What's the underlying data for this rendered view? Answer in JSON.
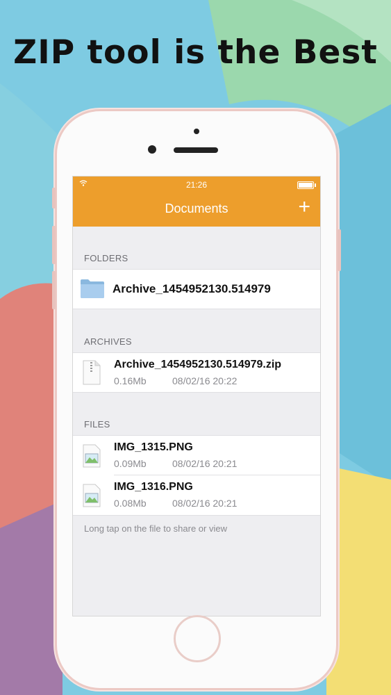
{
  "headline": "ZIP tool is the Best",
  "colors": {
    "accent": "#ed9e2c",
    "background_top": "#7fc9e3"
  },
  "status_bar": {
    "time": "21:26",
    "wifi_icon": "wifi-icon",
    "battery_icon": "battery-icon"
  },
  "nav": {
    "title": "Documents",
    "add_label": "+"
  },
  "sections": {
    "folders": {
      "header": "FOLDERS",
      "items": [
        {
          "name": "Archive_1454952130.514979",
          "icon": "folder-icon"
        }
      ]
    },
    "archives": {
      "header": "ARCHIVES",
      "items": [
        {
          "name": "Archive_1454952130.514979.zip",
          "size": "0.16Mb",
          "date": "08/02/16 20:22",
          "icon": "zip-file-icon"
        }
      ]
    },
    "files": {
      "header": "FILES",
      "items": [
        {
          "name": "IMG_1315.PNG",
          "size": "0.09Mb",
          "date": "08/02/16 20:21",
          "icon": "image-file-icon"
        },
        {
          "name": "IMG_1316.PNG",
          "size": "0.08Mb",
          "date": "08/02/16 20:21",
          "icon": "image-file-icon"
        }
      ]
    }
  },
  "footer_hint": "Long tap on the file to share or view"
}
